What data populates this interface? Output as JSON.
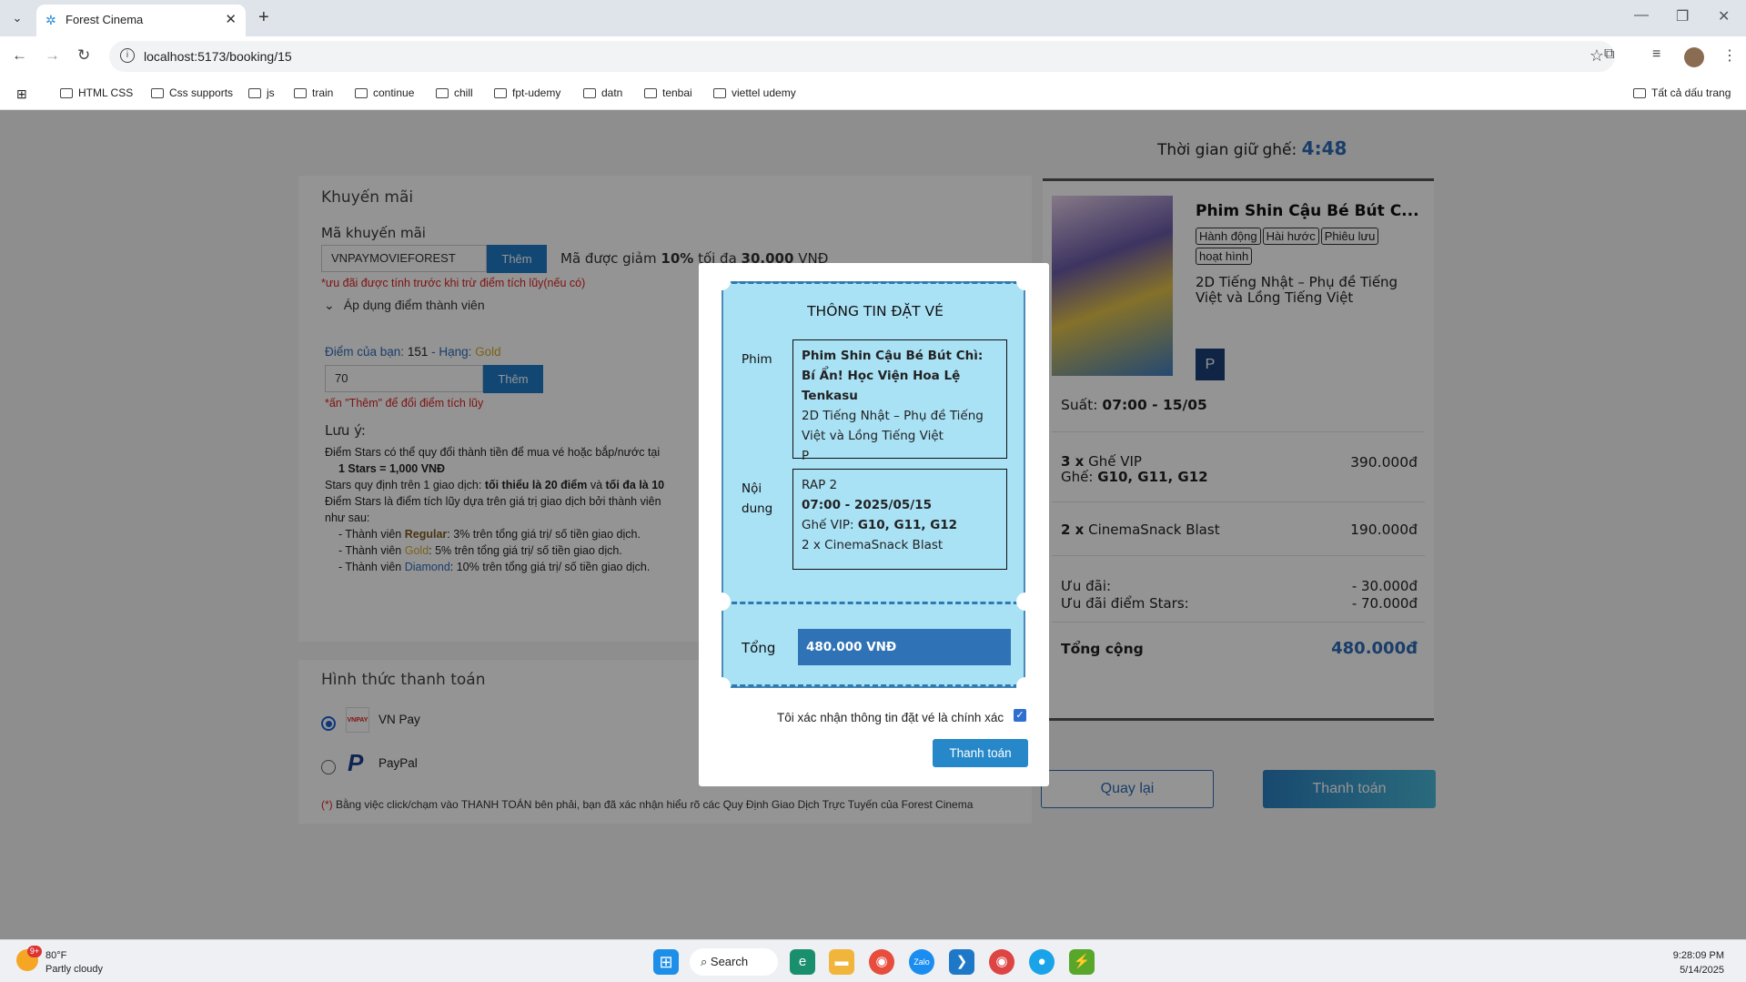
{
  "browser": {
    "tab_title": "Forest Cinema",
    "url": "localhost:5173/booking/15",
    "bookmarks": [
      "HTML CSS",
      "Css supports",
      "js",
      "train",
      "continue",
      "chill",
      "fpt-udemy",
      "datn",
      "tenbai",
      "viettel udemy"
    ],
    "all_bookmarks": "Tất cả dấu trang"
  },
  "timer": {
    "label": "Thời gian giữ ghế:",
    "value": "4:48"
  },
  "promo": {
    "title": "Khuyến mãi",
    "code_label": "Mã khuyến mãi",
    "code_value": "VNPAYMOVIEFOREST",
    "add_label": "Thêm",
    "discount_text_pre": "Mã được giảm ",
    "discount_pct": "10%",
    "discount_text_mid": " tối đa ",
    "discount_max": "30.000",
    "discount_unit": " VNĐ",
    "note": "*ưu đãi được tính trước khi trừ điểm tích lũy(nếu có)",
    "member_toggle": "Áp dụng điểm thành viên",
    "points_label": "Điểm của bạn:",
    "points_value": "151",
    "rank_label": "- Hạng:",
    "rank_value": "Gold",
    "points_input": "70",
    "points_add": "Thêm",
    "points_note": "*ấn \"Thêm\" để đổi điểm tích lũy",
    "notes_title": "Lưu ý:",
    "notes": [
      "Điểm Stars có thể quy đổi thành tiền để mua vé hoặc bắp/nước tại",
      "1 Stars = 1,000 VNĐ",
      "Stars quy định trên 1 giao dịch:",
      "tối thiểu là 20 điểm",
      "và",
      "tối đa là 10",
      "Điểm Stars là điểm tích lũy dựa trên giá trị giao dịch bởi thành viên",
      "như sau:",
      "- Thành viên",
      "Regular",
      ": 3% trên tổng giá trị/ số tiền giao dịch.",
      "Gold",
      ": 5% trên tổng giá trị/ số tiền giao dịch.",
      "Diamond",
      ": 10% trên tổng giá trị/ số tiền giao dịch."
    ]
  },
  "payment": {
    "title": "Hình thức thanh toán",
    "options": [
      "VN Pay",
      "PayPal"
    ],
    "selected": "VN Pay",
    "disclaimer_mark": "(*)",
    "disclaimer": " Bằng việc click/chạm vào THANH TOÁN bên phải, bạn đã xác nhận hiểu rõ các Quy Định Giao Dịch Trực Tuyến của Forest Cinema"
  },
  "summary": {
    "movie_title": "Phim Shin Cậu Bé Bút C...",
    "tags": [
      "Hành động",
      "Hài hước",
      "Phiêu lưu",
      "hoạt hình"
    ],
    "format": "2D",
    "language": "Tiếng Nhật – Phụ đề Tiếng Việt và Lồng Tiếng Việt",
    "rating": "P",
    "showtime_label": "Suất:",
    "showtime": "07:00 - 15/05",
    "seats_qty": "3 x",
    "seats_type": "Ghế VIP",
    "seats_label": "Ghế:",
    "seats_list": "G10, G11, G12",
    "seats_price": "390.000đ",
    "snack_qty": "2 x",
    "snack_name": "CinemaSnack Blast",
    "snack_price": "190.000đ",
    "promo_label": "Ưu đãi:",
    "promo_value": "- 30.000đ",
    "stars_label": "Ưu đãi điểm Stars:",
    "stars_value": "- 70.000đ",
    "total_label": "Tổng cộng",
    "total_value": "480.000đ",
    "back_btn": "Quay lại",
    "pay_btn": "Thanh toán"
  },
  "modal": {
    "title": "THÔNG TIN ĐẶT VÉ",
    "movie_label": "Phim",
    "movie_name": "Phim Shin Cậu Bé Bút Chì: Bí Ẩn! Học Viện Hoa Lệ Tenkasu",
    "movie_format": "2D Tiếng Nhật – Phụ đề Tiếng Việt và Lồng Tiếng Việt",
    "movie_rating": "P",
    "content_label_1": "Nội",
    "content_label_2": "dung",
    "room": "RAP 2",
    "datetime": "07:00 - 2025/05/15",
    "seat_prefix": "Ghế VIP: ",
    "seats": "G10, G11, G12",
    "snack": "2 x CinemaSnack Blast",
    "total_label": "Tổng",
    "total_value": "480.000 VNĐ",
    "confirm_text": "Tôi xác nhận thông tin đặt vé là chính xác",
    "pay_btn": "Thanh toán"
  },
  "taskbar": {
    "weather_temp": "80°F",
    "weather_desc": "Partly cloudy",
    "weather_badge": "9+",
    "search": "Search",
    "time": "9:28:09 PM",
    "date": "5/14/2025"
  }
}
